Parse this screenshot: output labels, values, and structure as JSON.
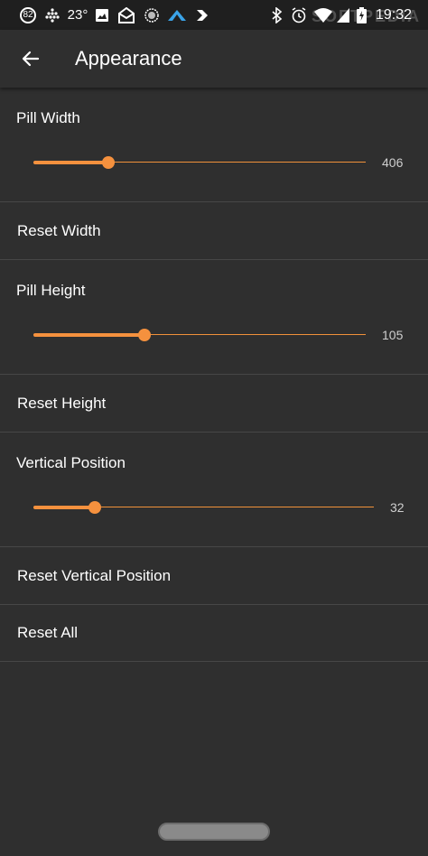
{
  "status_bar": {
    "badge": "82",
    "temperature": "23°",
    "time": "19:32",
    "watermark": "SOFTPEDIA"
  },
  "app_bar": {
    "title": "Appearance"
  },
  "settings": {
    "pill_width": {
      "label": "Pill Width",
      "value": "406",
      "fraction": 0.225
    },
    "reset_width": {
      "label": "Reset Width"
    },
    "pill_height": {
      "label": "Pill Height",
      "value": "105",
      "fraction": 0.333
    },
    "reset_height": {
      "label": "Reset Height"
    },
    "vertical_position": {
      "label": "Vertical Position",
      "value": "32",
      "fraction": 0.181
    },
    "reset_vertical_position": {
      "label": "Reset Vertical Position"
    },
    "reset_all": {
      "label": "Reset All"
    }
  },
  "colors": {
    "accent": "#f5913e",
    "background": "#2f2f2f",
    "status_bar": "#1f1f1f"
  },
  "icons": [
    "back-arrow-icon",
    "bluetooth-icon",
    "alarm-icon",
    "wifi-icon",
    "battery-charging-icon"
  ]
}
